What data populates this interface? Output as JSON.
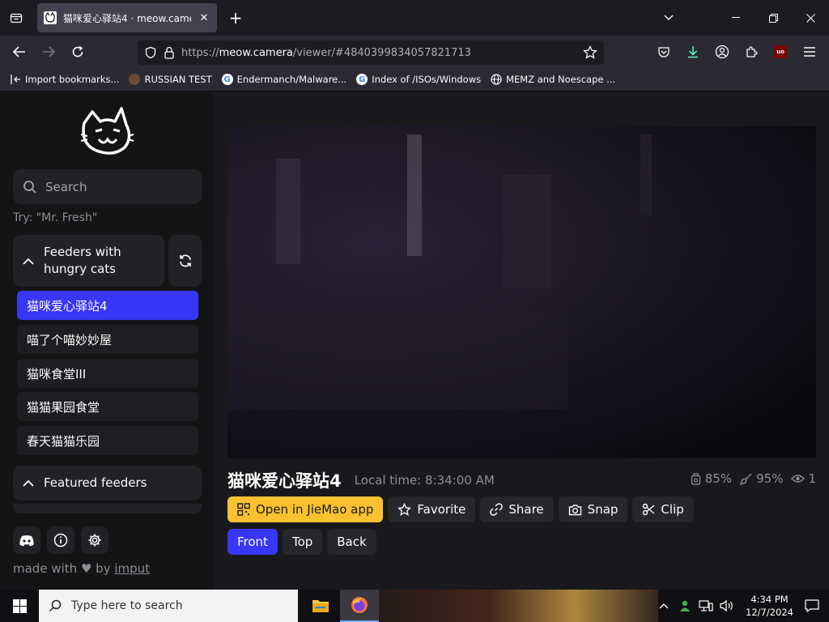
{
  "browser": {
    "tab": {
      "title": "猫咪爱心驿站4 · meow.camera"
    },
    "url": {
      "prefix": "https://",
      "host": "meow.camera",
      "path": "/viewer/#4840399834057821713"
    },
    "bookmarks": [
      {
        "label": "Import bookmarks...",
        "icon": "import-icon"
      },
      {
        "label": "RUSSIAN TEST",
        "icon": "site-icon"
      },
      {
        "label": "Endermanch/Malware...",
        "icon": "google-icon"
      },
      {
        "label": "Index of /ISOs/Windows",
        "icon": "google-icon"
      },
      {
        "label": "MEMZ and Noescape ...",
        "icon": "globe-icon"
      }
    ]
  },
  "sidebar": {
    "search_placeholder": "Search",
    "try_hint": "Try: \"Mr. Fresh\"",
    "group_hungry": "Feeders with hungry cats",
    "feeders": [
      {
        "label": "猫咪爱心驿站4",
        "active": true
      },
      {
        "label": "喵了个喵妙妙屋",
        "active": false
      },
      {
        "label": "猫咪食堂III",
        "active": false
      },
      {
        "label": "猫猫果园食堂",
        "active": false
      },
      {
        "label": "春天猫猫乐园",
        "active": false
      }
    ],
    "group_featured": "Featured feeders",
    "made_with": "made with",
    "by": "by",
    "author": "imput"
  },
  "viewer": {
    "title": "猫咪爱心驿站4",
    "local_time": "Local time: 8:34:00 AM",
    "food_level": "85%",
    "clean_level": "95%",
    "viewers": "1",
    "buttons": {
      "open_app": "Open in JieMao app",
      "favorite": "Favorite",
      "share": "Share",
      "snap": "Snap",
      "clip": "Clip"
    },
    "cameras": [
      {
        "label": "Front",
        "active": true
      },
      {
        "label": "Top",
        "active": false
      },
      {
        "label": "Back",
        "active": false
      }
    ]
  },
  "taskbar": {
    "search_placeholder": "Type here to search",
    "time": "4:34 PM",
    "date": "12/7/2024"
  },
  "colors": {
    "accent": "#3a36f5",
    "yellow": "#f9c12f"
  }
}
